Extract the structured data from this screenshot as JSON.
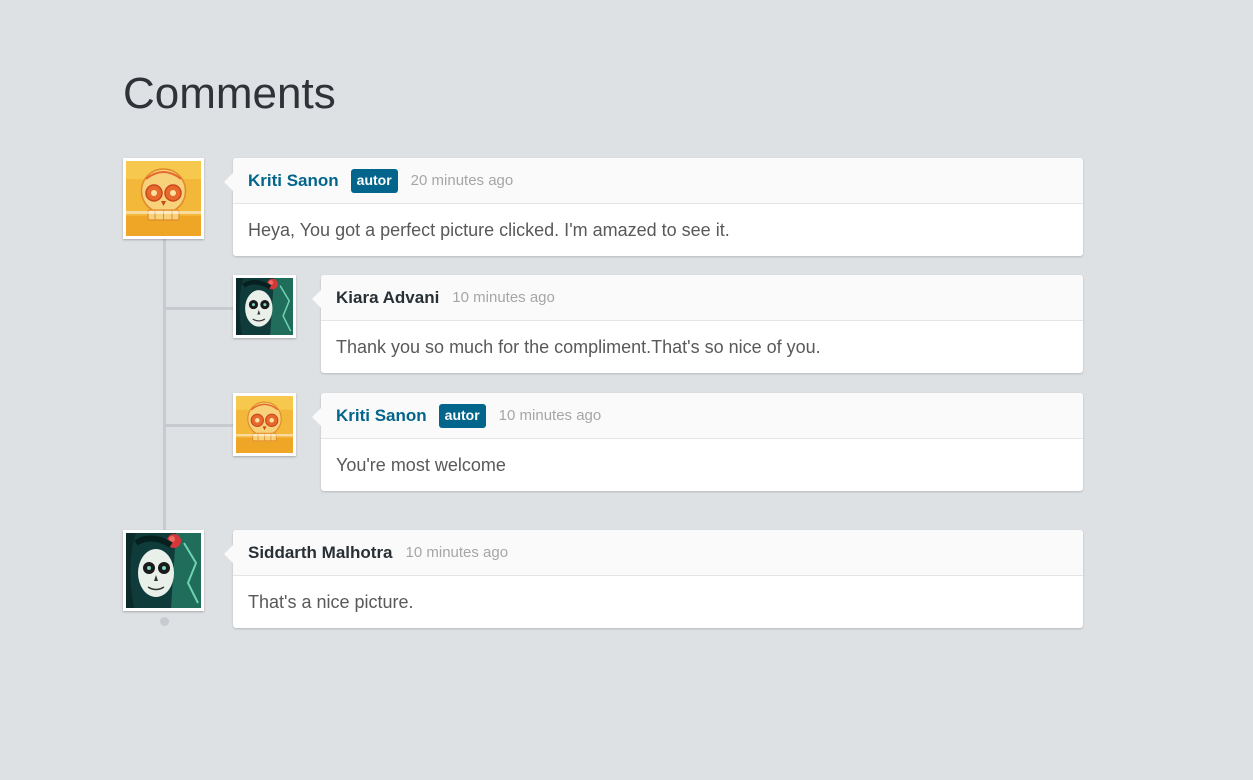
{
  "page": {
    "title": "Comments"
  },
  "colors": {
    "background": "#dee1e4",
    "author_name": "#03658c",
    "badge_bg": "#03658c",
    "name": "#283035",
    "time": "#a6a6a6",
    "text": "#595959"
  },
  "comments": [
    {
      "name": "Kriti Sanon",
      "badge": "autor",
      "time": "20 minutes ago",
      "text": "Heya, You got a perfect picture clicked. I'm amazed to see it.",
      "avatar_icon": "skull-avatar-icon",
      "replies": [
        {
          "name": "Kiara Advani",
          "time": "10 minutes ago",
          "text": "Thank you so much for the compliment.That's so nice of you.",
          "avatar_icon": "sugar-skull-woman-avatar-icon"
        },
        {
          "name": "Kriti Sanon",
          "badge": "autor",
          "time": "10 minutes ago",
          "text": "You're most welcome",
          "avatar_icon": "skull-avatar-icon"
        }
      ]
    },
    {
      "name": "Siddarth Malhotra",
      "time": "10 minutes ago",
      "text": "That's a nice picture.",
      "avatar_icon": "sugar-skull-woman-avatar-icon"
    }
  ]
}
